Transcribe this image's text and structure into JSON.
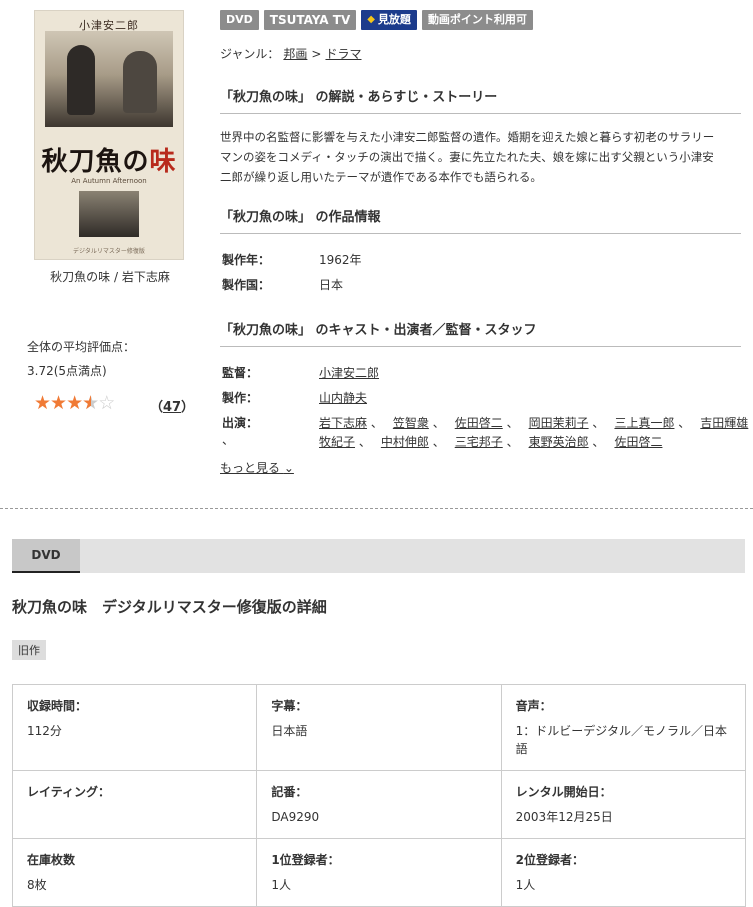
{
  "poster": {
    "top_text": "小津安二郎",
    "title_main": "秋刀魚の",
    "title_accent": "味",
    "subtitle": "An Autumn Afternoon",
    "footer": "デジタルリマスター修復版"
  },
  "caption": "秋刀魚の味 / 岩下志麻",
  "rating": {
    "label": "全体の平均評価点：",
    "value": "3.72(5点満点)",
    "score": 3.72,
    "max": 5,
    "count_open": "（",
    "count": "47",
    "count_close": "）"
  },
  "badges": [
    "DVD",
    "TSUTAYA TV",
    "見放題",
    "動画ポイント利用可"
  ],
  "genre": {
    "label": "ジャンル：",
    "items": [
      "邦画",
      "ドラマ"
    ],
    "sep": ">"
  },
  "sections": {
    "story_title": "「秋刀魚の味」 の解説・あらすじ・ストーリー",
    "info_title": "「秋刀魚の味」 の作品情報",
    "cast_title": "「秋刀魚の味」 のキャスト・出演者／監督・スタッフ"
  },
  "synopsis_lines": [
    "世界中の名監督に影響を与えた小津安二郎監督の遺作。婚期を迎えた娘と暮らす初老のサラリー",
    "マンの姿をコメディ・タッチの演出で描く。妻に先立たれた夫、娘を嫁に出す父親という小津安",
    "二郎が繰り返し用いたテーマが遺作である本作でも語られる。"
  ],
  "info": [
    {
      "label": "製作年：",
      "value": "1962年"
    },
    {
      "label": "製作国：",
      "value": "日本"
    }
  ],
  "staff": {
    "director_label": "監督：",
    "director": "小津安二郎",
    "producer_label": "製作：",
    "producer": "山内静夫",
    "cast_label": "出演：",
    "cast_line1": [
      "岩下志麻",
      "笠智衆",
      "佐田啓二",
      "岡田茉莉子",
      "三上真一郎",
      "吉田輝雄"
    ],
    "cast_line2": [
      "牧紀子",
      "中村伸郎",
      "三宅邦子",
      "東野英治郎",
      "佐田啓二"
    ],
    "sep": "、"
  },
  "more": {
    "label": "もっと見る",
    "icon": "chevron-down-icon"
  },
  "tab": {
    "label": "DVD"
  },
  "detail_title": "秋刀魚の味　デジタルリマスター修復版の詳細",
  "tag_old": "旧作",
  "details": [
    [
      {
        "label": "収録時間：",
        "value": "112分"
      },
      {
        "label": "字幕：",
        "value": "日本語"
      },
      {
        "label": "音声：",
        "value": "1：ドルビーデジタル／モノラル／日本語"
      }
    ],
    [
      {
        "label": "レイティング：",
        "value": ""
      },
      {
        "label": "記番：",
        "value": "DA9290"
      },
      {
        "label": "レンタル開始日：",
        "value": "2003年12月25日"
      }
    ],
    [
      {
        "label": "在庫枚数",
        "value": "8枚"
      },
      {
        "label": "1位登録者：",
        "value": "1人"
      },
      {
        "label": "2位登録者：",
        "value": "1人"
      }
    ]
  ]
}
